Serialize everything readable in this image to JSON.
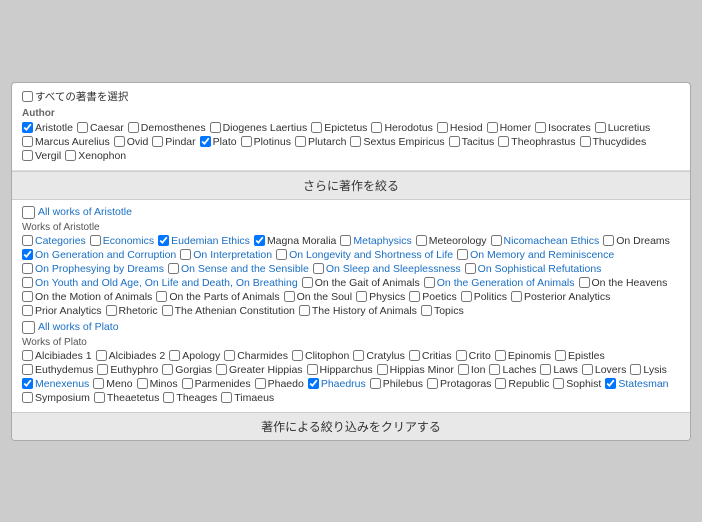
{
  "header": {
    "select_all_label": "すべての著書を選択"
  },
  "author_section": {
    "label": "Author",
    "authors": [
      {
        "name": "Aristotle",
        "checked": true,
        "blue": false
      },
      {
        "name": "Caesar",
        "checked": false,
        "blue": false
      },
      {
        "name": "Demosthenes",
        "checked": false,
        "blue": false
      },
      {
        "name": "Diogenes Laertius",
        "checked": false,
        "blue": false
      },
      {
        "name": "Epictetus",
        "checked": false,
        "blue": false
      },
      {
        "name": "Herodotus",
        "checked": false,
        "blue": false
      },
      {
        "name": "Hesiod",
        "checked": false,
        "blue": false
      },
      {
        "name": "Homer",
        "checked": false,
        "blue": false
      },
      {
        "name": "Isocrates",
        "checked": false,
        "blue": false
      },
      {
        "name": "Lucretius",
        "checked": false,
        "blue": false
      },
      {
        "name": "Marcus Aurelius",
        "checked": false,
        "blue": false
      },
      {
        "name": "Ovid",
        "checked": false,
        "blue": false
      },
      {
        "name": "Pindar",
        "checked": false,
        "blue": false
      },
      {
        "name": "Plato",
        "checked": true,
        "blue": false
      },
      {
        "name": "Plotinus",
        "checked": false,
        "blue": false
      },
      {
        "name": "Plutarch",
        "checked": false,
        "blue": false
      },
      {
        "name": "Sextus Empiricus",
        "checked": false,
        "blue": false
      },
      {
        "name": "Tacitus",
        "checked": false,
        "blue": false
      },
      {
        "name": "Theophrastus",
        "checked": false,
        "blue": false
      },
      {
        "name": "Thucydides",
        "checked": false,
        "blue": false
      },
      {
        "name": "Vergil",
        "checked": false,
        "blue": false
      },
      {
        "name": "Xenophon",
        "checked": false,
        "blue": false
      }
    ]
  },
  "filter_bar": {
    "label": "さらに著作を絞る"
  },
  "aristotle_section": {
    "all_works_label": "All works of Aristotle",
    "group_label": "Works of Aristotle",
    "works": [
      {
        "name": "Categories",
        "checked": false,
        "blue": true
      },
      {
        "name": "Economics",
        "checked": false,
        "blue": true
      },
      {
        "name": "Eudemian Ethics",
        "checked": true,
        "blue": true
      },
      {
        "name": "Magna Moralia",
        "checked": true,
        "blue": false
      },
      {
        "name": "Metaphysics",
        "checked": false,
        "blue": true
      },
      {
        "name": "Meteorology",
        "checked": false,
        "blue": false
      },
      {
        "name": "Nicomachean Ethics",
        "checked": false,
        "blue": true
      },
      {
        "name": "On Dreams",
        "checked": false,
        "blue": false
      },
      {
        "name": "On Generation and Corruption",
        "checked": true,
        "blue": true
      },
      {
        "name": "On Interpretation",
        "checked": false,
        "blue": true
      },
      {
        "name": "On Longevity and Shortness of Life",
        "checked": false,
        "blue": true
      },
      {
        "name": "On Memory and Reminiscence",
        "checked": false,
        "blue": true
      },
      {
        "name": "On Prophesying by Dreams",
        "checked": false,
        "blue": true
      },
      {
        "name": "On Sense and the Sensible",
        "checked": false,
        "blue": true
      },
      {
        "name": "On Sleep and Sleeplessness",
        "checked": false,
        "blue": true
      },
      {
        "name": "On Sophistical Refutations",
        "checked": false,
        "blue": true
      },
      {
        "name": "On Youth and Old Age, On Life and Death, On Breathing",
        "checked": false,
        "blue": true
      },
      {
        "name": "On the Gait of Animals",
        "checked": false,
        "blue": false
      },
      {
        "name": "On the Generation of Animals",
        "checked": false,
        "blue": true
      },
      {
        "name": "On the Heavens",
        "checked": false,
        "blue": false
      },
      {
        "name": "On the Motion of Animals",
        "checked": false,
        "blue": false
      },
      {
        "name": "On the Parts of Animals",
        "checked": false,
        "blue": false
      },
      {
        "name": "On the Soul",
        "checked": false,
        "blue": false
      },
      {
        "name": "Physics",
        "checked": false,
        "blue": false
      },
      {
        "name": "Poetics",
        "checked": false,
        "blue": false
      },
      {
        "name": "Politics",
        "checked": false,
        "blue": false
      },
      {
        "name": "Posterior Analytics",
        "checked": false,
        "blue": false
      },
      {
        "name": "Prior Analytics",
        "checked": false,
        "blue": false
      },
      {
        "name": "Rhetoric",
        "checked": false,
        "blue": false
      },
      {
        "name": "The Athenian Constitution",
        "checked": false,
        "blue": false
      },
      {
        "name": "The History of Animals",
        "checked": false,
        "blue": false
      },
      {
        "name": "Topics",
        "checked": false,
        "blue": false
      }
    ]
  },
  "plato_section": {
    "all_works_label": "All works of Plato",
    "group_label": "Works of Plato",
    "works": [
      {
        "name": "Alcibiades 1",
        "checked": false,
        "blue": false
      },
      {
        "name": "Alcibiades 2",
        "checked": false,
        "blue": false
      },
      {
        "name": "Apology",
        "checked": false,
        "blue": false
      },
      {
        "name": "Charmides",
        "checked": false,
        "blue": false
      },
      {
        "name": "Clitophon",
        "checked": false,
        "blue": false
      },
      {
        "name": "Cratylus",
        "checked": false,
        "blue": false
      },
      {
        "name": "Critias",
        "checked": false,
        "blue": false
      },
      {
        "name": "Crito",
        "checked": false,
        "blue": false
      },
      {
        "name": "Epinomis",
        "checked": false,
        "blue": false
      },
      {
        "name": "Epistles",
        "checked": false,
        "blue": false
      },
      {
        "name": "Euthydemus",
        "checked": false,
        "blue": false
      },
      {
        "name": "Euthyphro",
        "checked": false,
        "blue": false
      },
      {
        "name": "Gorgias",
        "checked": false,
        "blue": false
      },
      {
        "name": "Greater Hippias",
        "checked": false,
        "blue": false
      },
      {
        "name": "Hipparchus",
        "checked": false,
        "blue": false
      },
      {
        "name": "Hippias Minor",
        "checked": false,
        "blue": false
      },
      {
        "name": "Ion",
        "checked": false,
        "blue": false
      },
      {
        "name": "Laches",
        "checked": false,
        "blue": false
      },
      {
        "name": "Laws",
        "checked": false,
        "blue": false
      },
      {
        "name": "Lovers",
        "checked": false,
        "blue": false
      },
      {
        "name": "Lysis",
        "checked": false,
        "blue": false
      },
      {
        "name": "Menexenus",
        "checked": true,
        "blue": true
      },
      {
        "name": "Meno",
        "checked": false,
        "blue": false
      },
      {
        "name": "Minos",
        "checked": false,
        "blue": false
      },
      {
        "name": "Parmenides",
        "checked": false,
        "blue": false
      },
      {
        "name": "Phaedo",
        "checked": false,
        "blue": false
      },
      {
        "name": "Phaedrus",
        "checked": true,
        "blue": true
      },
      {
        "name": "Philebus",
        "checked": false,
        "blue": false
      },
      {
        "name": "Protagoras",
        "checked": false,
        "blue": false
      },
      {
        "name": "Republic",
        "checked": false,
        "blue": false
      },
      {
        "name": "Sophist",
        "checked": false,
        "blue": false
      },
      {
        "name": "Statesman",
        "checked": true,
        "blue": true
      },
      {
        "name": "Symposium",
        "checked": false,
        "blue": false
      },
      {
        "name": "Theaetetus",
        "checked": false,
        "blue": false
      },
      {
        "name": "Theages",
        "checked": false,
        "blue": false
      },
      {
        "name": "Timaeus",
        "checked": false,
        "blue": false
      }
    ]
  },
  "bottom_bar": {
    "label": "著作による絞り込みをクリアする"
  }
}
